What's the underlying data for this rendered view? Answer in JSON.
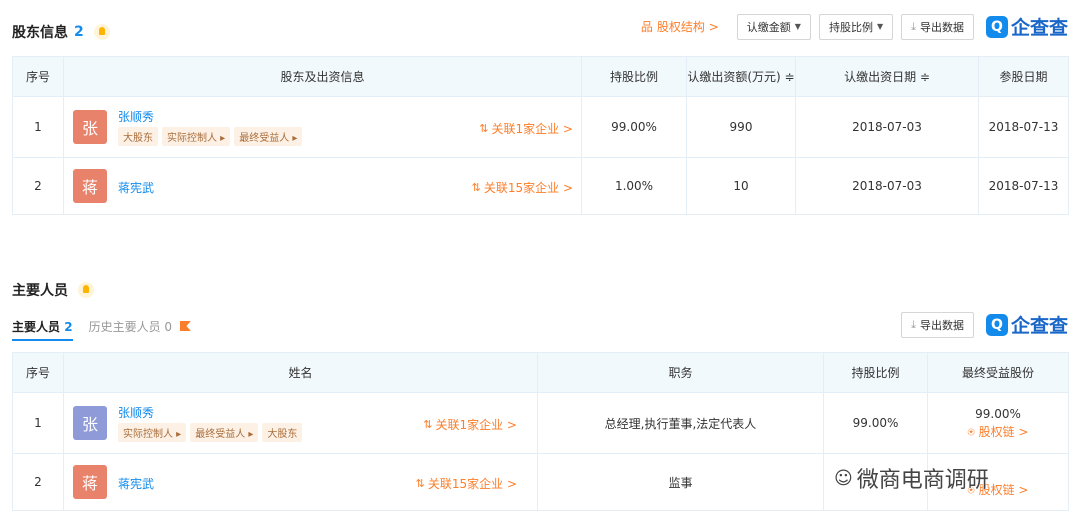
{
  "shareholders": {
    "title": "股东信息",
    "count": "2",
    "toolbar": {
      "equity_link": "股权结构 >",
      "amount_btn": "认缴金额",
      "ratio_btn": "持股比例",
      "export_btn": "导出数据",
      "logo_text": "企查查"
    },
    "headers": [
      "序号",
      "股东及出资信息",
      "持股比例",
      "认缴出资额(万元) ≑",
      "认缴出资日期 ≑",
      "参股日期"
    ],
    "rows": [
      {
        "no": "1",
        "avatar": "张",
        "avatar_color": "#e9826b",
        "name": "张顺秀",
        "tags": [
          "大股东",
          "实际控制人 ▸",
          "最终受益人 ▸"
        ],
        "related": "关联1家企业 >",
        "ratio": "99.00%",
        "amount": "990",
        "sub_date": "2018-07-03",
        "join_date": "2018-07-13"
      },
      {
        "no": "2",
        "avatar": "蒋",
        "avatar_color": "#e9826b",
        "name": "蒋宪武",
        "tags": [],
        "related": "关联15家企业 >",
        "ratio": "1.00%",
        "amount": "10",
        "sub_date": "2018-07-03",
        "join_date": "2018-07-13"
      }
    ]
  },
  "personnel": {
    "title": "主要人员",
    "tab_active": "主要人员",
    "tab_active_count": "2",
    "tab_history": "历史主要人员 0",
    "toolbar": {
      "export_btn": "导出数据",
      "logo_text": "企查查"
    },
    "headers": [
      "序号",
      "姓名",
      "职务",
      "持股比例",
      "最终受益股份"
    ],
    "rows": [
      {
        "no": "1",
        "avatar": "张",
        "avatar_color": "#8f9bd9",
        "name": "张顺秀",
        "tags": [
          "实际控制人 ▸",
          "最终受益人 ▸",
          "大股东"
        ],
        "related": "关联1家企业 >",
        "position": "总经理,执行董事,法定代表人",
        "ratio": "99.00%",
        "benefit": "99.00%",
        "benefit_link": "股权链 >"
      },
      {
        "no": "2",
        "avatar": "蒋",
        "avatar_color": "#e9826b",
        "name": "蒋宪武",
        "tags": [],
        "related": "关联15家企业 >",
        "position": "监事",
        "ratio": "",
        "benefit": "",
        "benefit_link": "股权链 >"
      }
    ]
  },
  "watermark": "微商电商调研"
}
